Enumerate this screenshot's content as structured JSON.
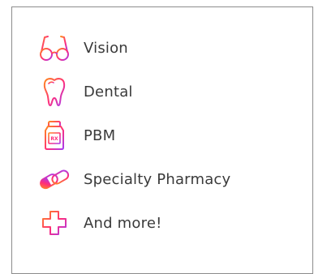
{
  "benefits": {
    "items": [
      {
        "label": "Vision",
        "icon": "eyeglasses-icon"
      },
      {
        "label": "Dental",
        "icon": "tooth-icon"
      },
      {
        "label": "PBM",
        "icon": "pill-bottle-icon"
      },
      {
        "label": "Specialty Pharmacy",
        "icon": "capsule-icon"
      },
      {
        "label": "And more!",
        "icon": "medical-cross-icon"
      }
    ]
  },
  "colors": {
    "gradient_start": "#ff8a1f",
    "gradient_mid": "#ff2d7a",
    "gradient_end": "#a63cf2",
    "text": "#3a3a3a",
    "border": "#8c8c8c"
  }
}
